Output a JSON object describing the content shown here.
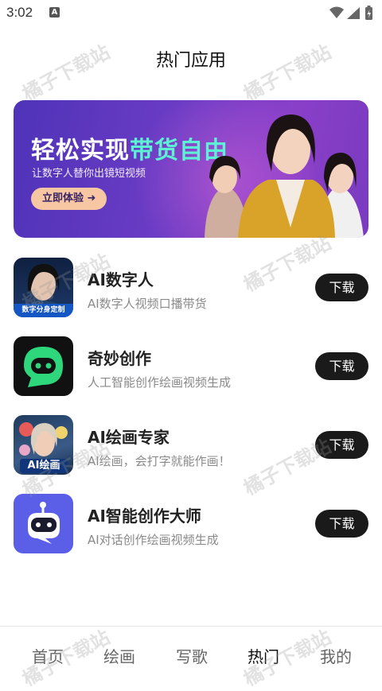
{
  "status_bar": {
    "time": "3:02",
    "notif_icon": "a-letter-icon"
  },
  "page": {
    "title": "热门应用"
  },
  "banner": {
    "headline_prefix": "轻松实现",
    "headline_highlight": "带货自由",
    "subtitle": "让数字人替你出镜短视频",
    "cta": "立即体验 ➜"
  },
  "apps": [
    {
      "name": "AI数字人",
      "desc": "AI数字人视频口播带货",
      "button": "下载",
      "icon_label": "数字分身定制"
    },
    {
      "name": "奇妙创作",
      "desc": "人工智能创作绘画视频生成",
      "button": "下载",
      "icon_label": ""
    },
    {
      "name": "AI绘画专家",
      "desc": "AI绘画，会打字就能作画！",
      "button": "下载",
      "icon_label": "AI绘画"
    },
    {
      "name": "AI智能创作大师",
      "desc": "AI对话创作绘画视频生成",
      "button": "下载",
      "icon_label": ""
    }
  ],
  "tabs": [
    {
      "label": "首页",
      "active": false
    },
    {
      "label": "绘画",
      "active": false
    },
    {
      "label": "写歌",
      "active": false
    },
    {
      "label": "热门",
      "active": true
    },
    {
      "label": "我的",
      "active": false
    }
  ],
  "watermark": "橘子下载站",
  "colors": {
    "accent_teal": "#5ef2d4",
    "button_dark": "#1a1a1a",
    "banner_purple": "#6c3cc5"
  }
}
